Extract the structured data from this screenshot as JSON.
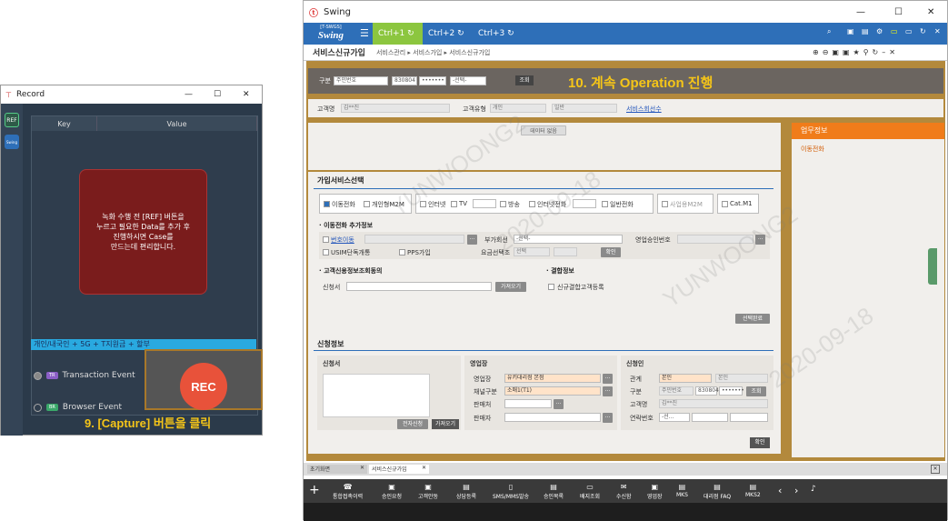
{
  "record": {
    "title": "Record",
    "side_ref": "REF",
    "side_swing": "Swing",
    "col_key": "Key",
    "col_value": "Value",
    "notice": "녹화 수행 전 [REF] 버튼을\n누르고 필요한 Data를 추가 후\n진행하시면 Case를\n만드는데 편리합니다.",
    "bar_text": "개인/내국인 + 5G + T지원금 + 할부",
    "tx_tag": "TR",
    "tx_label": "Transaction Event",
    "br_tag": "BR",
    "br_label": "Browser Event",
    "rec_label": "REC",
    "caption": "9. [Capture] 버튼을 클릭"
  },
  "swing": {
    "title": "Swing",
    "logo_sub": "[T-SWGS]",
    "logo": "Swing",
    "ctrl1": "Ctrl+1",
    "ctrl2": "Ctrl+2",
    "ctrl3": "Ctrl+3",
    "page_title": "서비스신규가입",
    "breadcrumb": "서비스관리 ▸ 서비스가입 ▸ 서비스신규가입",
    "search": {
      "label": "구분",
      "type": "주민번호",
      "id_front": "830804",
      "id_back": "•••••••",
      "select": "-선택-",
      "btn": "조회"
    },
    "banner": "10. 계속 Operation 진행",
    "cust": {
      "name_label": "고객명",
      "name": "김**진",
      "type_label": "고객유형",
      "type": "개인",
      "type2": "일반",
      "link": "서비스회선수"
    },
    "no_data": "데이터 없음",
    "sub_tab": "가입서비스선택",
    "svc": {
      "mobile": "이동전화",
      "m2m": "개인형M2M",
      "internet": "인터넷",
      "tv": "TV",
      "phone": "방송",
      "iphone": "인터넷전화",
      "general": "일반전화",
      "biz": "사업용M2M",
      "catm": "Cat.M1"
    },
    "mobile_extra": {
      "title": "· 이동전화 추가정보",
      "num_move": "번호이동",
      "addon_label": "부가회선",
      "addon_val": "-선택-",
      "approve_label": "영업승인번호",
      "usim": "USIM단독개통",
      "pps": "PPS가입",
      "rate_label": "요금선택조",
      "rate_val": "선택",
      "confirm": "확인"
    },
    "consent": {
      "title": "· 고객신용정보조회동의",
      "doc_label": "신청서",
      "btn": "가져오기"
    },
    "combine": {
      "title": "· 결합정보",
      "chk": "신규결합고객등록",
      "done": "선택완료"
    },
    "apply_tab": "신청정보",
    "apply": {
      "doc": "신청서",
      "btn_e": "전자신청",
      "btn_get": "가져오기"
    },
    "sales": {
      "title": "영업장",
      "shop_label": "영업장",
      "shop_val": "유키대리점 본점",
      "ch_label": "채널구분",
      "ch_val": "소매1(T1)",
      "seller_label": "판매처",
      "person_label": "판매자"
    },
    "applicant": {
      "title": "신청인",
      "rel_label": "관계",
      "rel_val": "본인",
      "rel_val2": "본인",
      "cls_label": "구분",
      "cls_val": "주민번호",
      "front": "830804",
      "back": "•••••••",
      "btn": "조회",
      "name_label": "고객명",
      "name": "김**진",
      "contact_label": "연락번호",
      "contact_val": "-선...",
      "ok": "확인"
    },
    "right_panel": {
      "title": "업무정보",
      "item": "이동전화"
    },
    "screen_tabs": [
      "초기화면",
      "서비스신규가입"
    ],
    "bottom_icons": [
      "통합접촉이력",
      "승인요청",
      "고객안동",
      "상담등록",
      "SMS/MMS발송",
      "승인목록",
      "배지조회",
      "수신함",
      "영업장",
      "MKS",
      "대리점 FAQ",
      "MKS2"
    ],
    "watermark1": "YUNWOONG2",
    "watermark2": "2020-09-18"
  }
}
